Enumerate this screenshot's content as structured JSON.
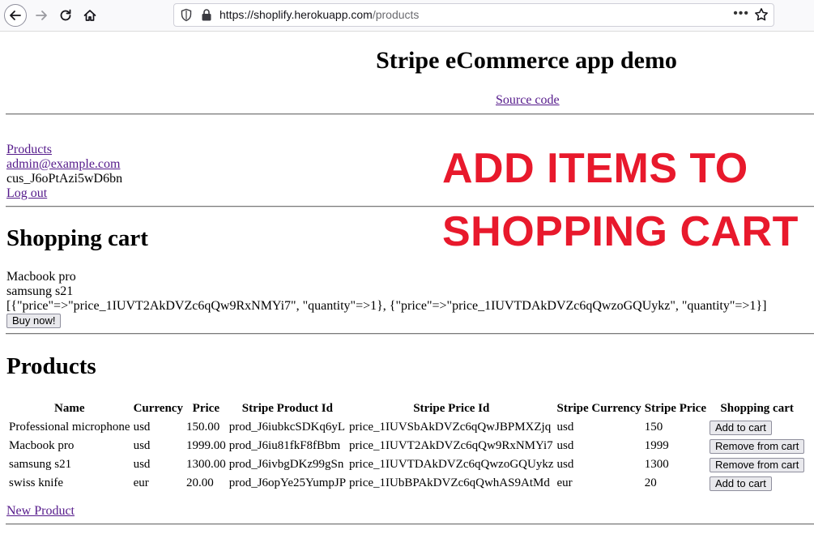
{
  "browser": {
    "url_host": "https://shoplify.herokuapp.com",
    "url_path": "/products",
    "more_label": "•••"
  },
  "header": {
    "title": "Stripe eCommerce app demo",
    "source_link": "Source code"
  },
  "nav": {
    "products_link": "Products",
    "email_link": "admin@example.com",
    "customer_id": "cus_J6oPtAzi5wD6bn",
    "logout_link": "Log out"
  },
  "overlay": {
    "line1": "ADD ITEMS TO",
    "line2": "SHOPPING CART",
    "color": "#e8192c"
  },
  "cart": {
    "heading": "Shopping cart",
    "items": [
      "Macbook pro",
      "samsung s21"
    ],
    "line_items_text": "[{\"price\"=>\"price_1IUVT2AkDVZc6qQw9RxNMYi7\", \"quantity\"=>1}, {\"price\"=>\"price_1IUVTDAkDVZc6qQwzoGQUykz\", \"quantity\"=>1}]",
    "buy_button": "Buy now!"
  },
  "products": {
    "heading": "Products",
    "columns": [
      "Name",
      "Currency",
      "Price",
      "Stripe Product Id",
      "Stripe Price Id",
      "Stripe Currency",
      "Stripe Price",
      "Shopping cart"
    ],
    "rows": [
      [
        "Professional microphone",
        "usd",
        "150.00",
        "prod_J6iubkcSDKq6yL",
        "price_1IUVSbAkDVZc6qQwJBPMXZjq",
        "usd",
        "150",
        "Add to cart"
      ],
      [
        "Macbook pro",
        "usd",
        "1999.00",
        "prod_J6iu81fkF8fBbm",
        "price_1IUVT2AkDVZc6qQw9RxNMYi7",
        "usd",
        "1999",
        "Remove from cart"
      ],
      [
        "samsung s21",
        "usd",
        "1300.00",
        "prod_J6ivbgDKz99gSn",
        "price_1IUVTDAkDVZc6qQwzoGQUykz",
        "usd",
        "1300",
        "Remove from cart"
      ],
      [
        "swiss knife",
        "eur",
        "20.00",
        "prod_J6opYe25YumpJP",
        "price_1IUbBPAkDVZc6qQwhAS9AtMd",
        "eur",
        "20",
        "Add to cart"
      ]
    ],
    "new_product_link": "New Product"
  }
}
